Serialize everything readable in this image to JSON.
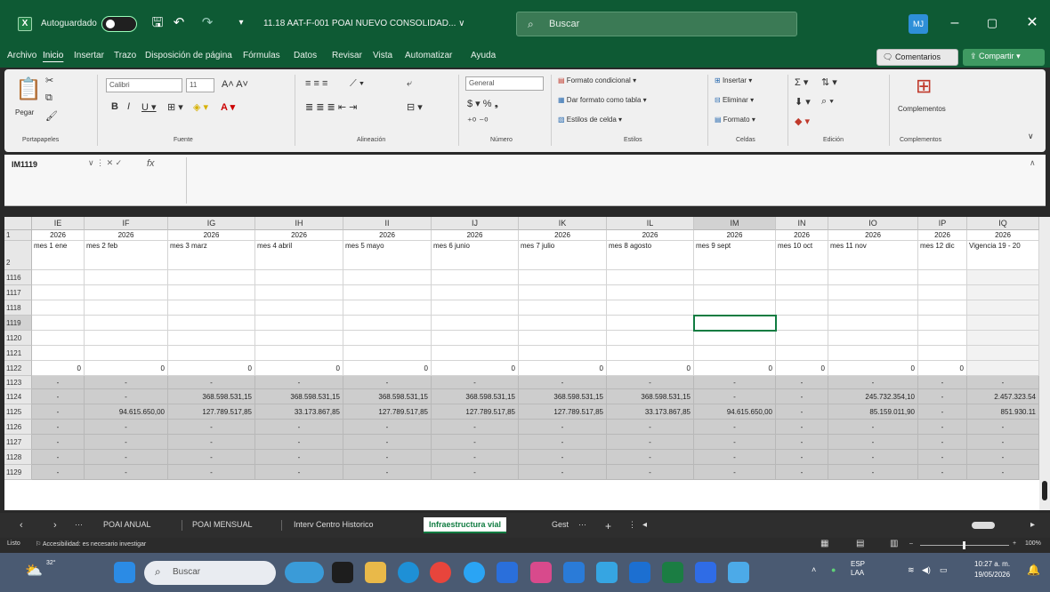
{
  "titlebar": {
    "autosave_label": "Autoguardado",
    "filename": "11.18 AAT-F-001 POAI NUEVO CONSOLIDAD... ∨",
    "search_placeholder": "Buscar",
    "avatar": "MJ"
  },
  "menu": {
    "items": [
      "Archivo",
      "Inicio",
      "Insertar",
      "Trazo",
      "Disposición de página",
      "Fórmulas",
      "Datos",
      "Revisar",
      "Vista",
      "Automatizar",
      "Ayuda"
    ],
    "comments": "Comentarios",
    "share": "Compartir"
  },
  "ribbon": {
    "groups": [
      "Portapapeles",
      "Fuente",
      "Alineación",
      "Número",
      "Estilos",
      "Celdas",
      "Edición",
      "Complementos"
    ],
    "paste": "Pegar",
    "font_name": "Calibri",
    "font_size": "11",
    "number_format": "General",
    "cond_format": "Formato condicional",
    "table_format": "Dar formato como tabla",
    "cell_styles": "Estilos de celda",
    "insert": "Insertar",
    "delete": "Eliminar",
    "format": "Formato",
    "addins": "Complementos"
  },
  "formula": {
    "namebox": "IM1119",
    "fx": "fx"
  },
  "columns": [
    "IE",
    "IF",
    "IG",
    "IH",
    "II",
    "IJ",
    "IK",
    "IL",
    "IM",
    "IN",
    "IO",
    "IP",
    "IQ"
  ],
  "row1": [
    "2026",
    "2026",
    "2026",
    "2026",
    "2026",
    "2026",
    "2026",
    "2026",
    "2026",
    "2026",
    "2026",
    "2026",
    "2026"
  ],
  "row2": [
    "mes 1 ene",
    "mes 2 feb",
    "mes 3 marz",
    "mes 4 abril",
    "mes 5 mayo",
    "mes 6 junio",
    "mes 7 julio",
    "mes 8 agosto",
    "mes 9 sept",
    "mes 10 oct",
    "mes 11 nov",
    "mes 12 dic",
    "Vigencia 19 - 20"
  ],
  "row_numbers": [
    "1",
    "2",
    "1116",
    "1117",
    "1118",
    "1119",
    "1120",
    "1121",
    "1122",
    "1123",
    "1124",
    "1125",
    "1126",
    "1127",
    "1128",
    "1129"
  ],
  "row1122": [
    "0",
    "0",
    "0",
    "0",
    "0",
    "0",
    "0",
    "0",
    "0",
    "0",
    "0",
    "0",
    ""
  ],
  "row1123": [
    "-",
    "-",
    "-",
    "-",
    "-",
    "-",
    "-",
    "-",
    "-",
    "-",
    "-",
    "-",
    "-"
  ],
  "row1124": [
    "-",
    "-",
    "368.598.531,15",
    "368.598.531,15",
    "368.598.531,15",
    "368.598.531,15",
    "368.598.531,15",
    "368.598.531,15",
    "-",
    "-",
    "245.732.354,10",
    "-",
    "2.457.323.54"
  ],
  "row1125": [
    "-",
    "94.615.650,00",
    "127.789.517,85",
    "33.173.867,85",
    "127.789.517,85",
    "127.789.517,85",
    "127.789.517,85",
    "33.173.867,85",
    "94.615.650,00",
    "-",
    "85.159.011,90",
    "-",
    "851.930.11"
  ],
  "row1126": [
    "-",
    "-",
    "-",
    "-",
    "-",
    "-",
    "-",
    "-",
    "-",
    "-",
    "-",
    "-",
    "-"
  ],
  "row1127": [
    "-",
    "-",
    "-",
    "-",
    "-",
    "-",
    "-",
    "-",
    "-",
    "-",
    "-",
    "-",
    "-"
  ],
  "row1128": [
    "-",
    "-",
    "-",
    "-",
    "-",
    "-",
    "-",
    "-",
    "-",
    "-",
    "-",
    "-",
    "-"
  ],
  "row1129": [
    "-",
    "-",
    "-",
    "-",
    "-",
    "-",
    "-",
    "-",
    "-",
    "-",
    "-",
    "-",
    "-"
  ],
  "tabs": [
    "POAI ANUAL",
    "POAI MENSUAL",
    "Interv Centro Historico",
    "Infraestructura vial",
    "Gest"
  ],
  "active_tab": "Infraestructura vial",
  "status": {
    "ready": "Listo",
    "accessibility": "Accesibilidad: es necesario investigar",
    "zoom": "100%"
  },
  "taskbar": {
    "weather": "32°",
    "search_placeholder": "Buscar",
    "lang1": "ESP",
    "lang2": "LAA",
    "time": "10:27 a. m.",
    "date": "19/05/2026"
  }
}
